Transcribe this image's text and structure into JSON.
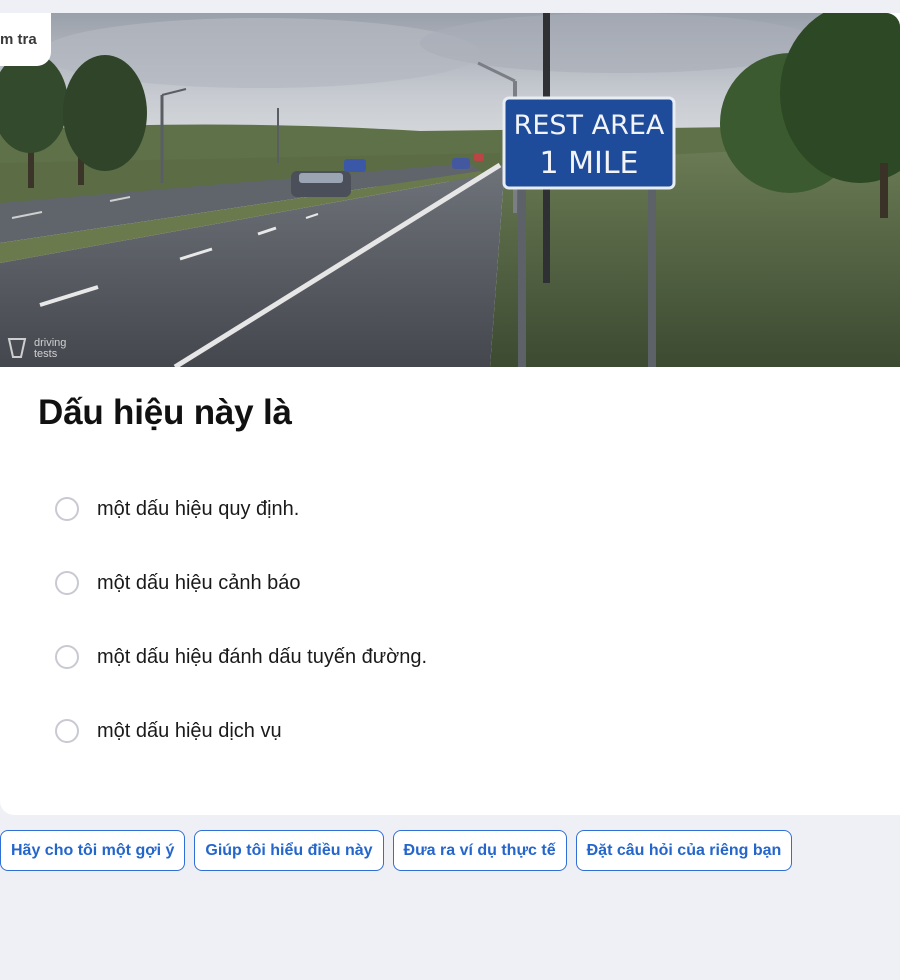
{
  "header": {
    "tab_label": "m tra"
  },
  "image": {
    "sign_line1": "REST AREA",
    "sign_line2": "1 MILE",
    "watermark_line1": "driving",
    "watermark_line2": "tests"
  },
  "question": {
    "title": "Dấu hiệu này là"
  },
  "options": [
    "một dấu hiệu quy định.",
    "một dấu hiệu cảnh báo",
    "một dấu hiệu đánh dấu tuyến đường.",
    "một dấu hiệu dịch vụ"
  ],
  "actions": [
    "Hãy cho tôi một gợi ý",
    "Giúp tôi hiểu điều này",
    "Đưa ra ví dụ thực tế",
    "Đặt câu hỏi của riêng bạn"
  ],
  "colors": {
    "accent": "#2466cc",
    "page_bg": "#eff0f6",
    "sign_blue": "#1f4c9a"
  }
}
